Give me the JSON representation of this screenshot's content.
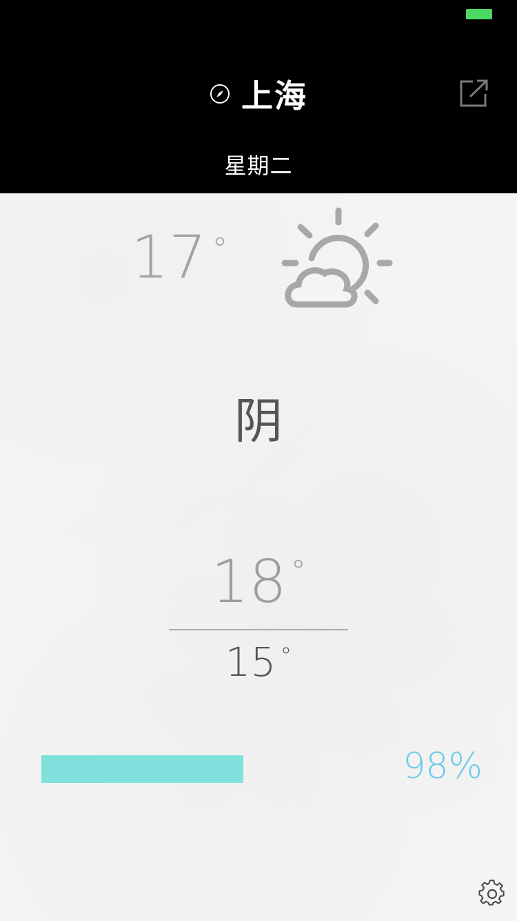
{
  "status_bar": {
    "battery_color": "#4cd964"
  },
  "header": {
    "city": "上海",
    "weekday": "星期二",
    "location_icon": "compass-icon",
    "share_icon": "share-external-icon"
  },
  "current": {
    "temperature": "17",
    "degree_symbol": "°",
    "condition": "阴",
    "weather_icon": "partly-cloudy-sun-icon"
  },
  "range": {
    "high": "18",
    "low": "15",
    "degree_symbol": "°"
  },
  "humidity": {
    "value_text": "98%",
    "bar_fraction": 0.505,
    "bar_color": "#7fe0dc",
    "text_color": "#6ccbe8"
  },
  "footer": {
    "settings_icon": "gear-icon"
  }
}
